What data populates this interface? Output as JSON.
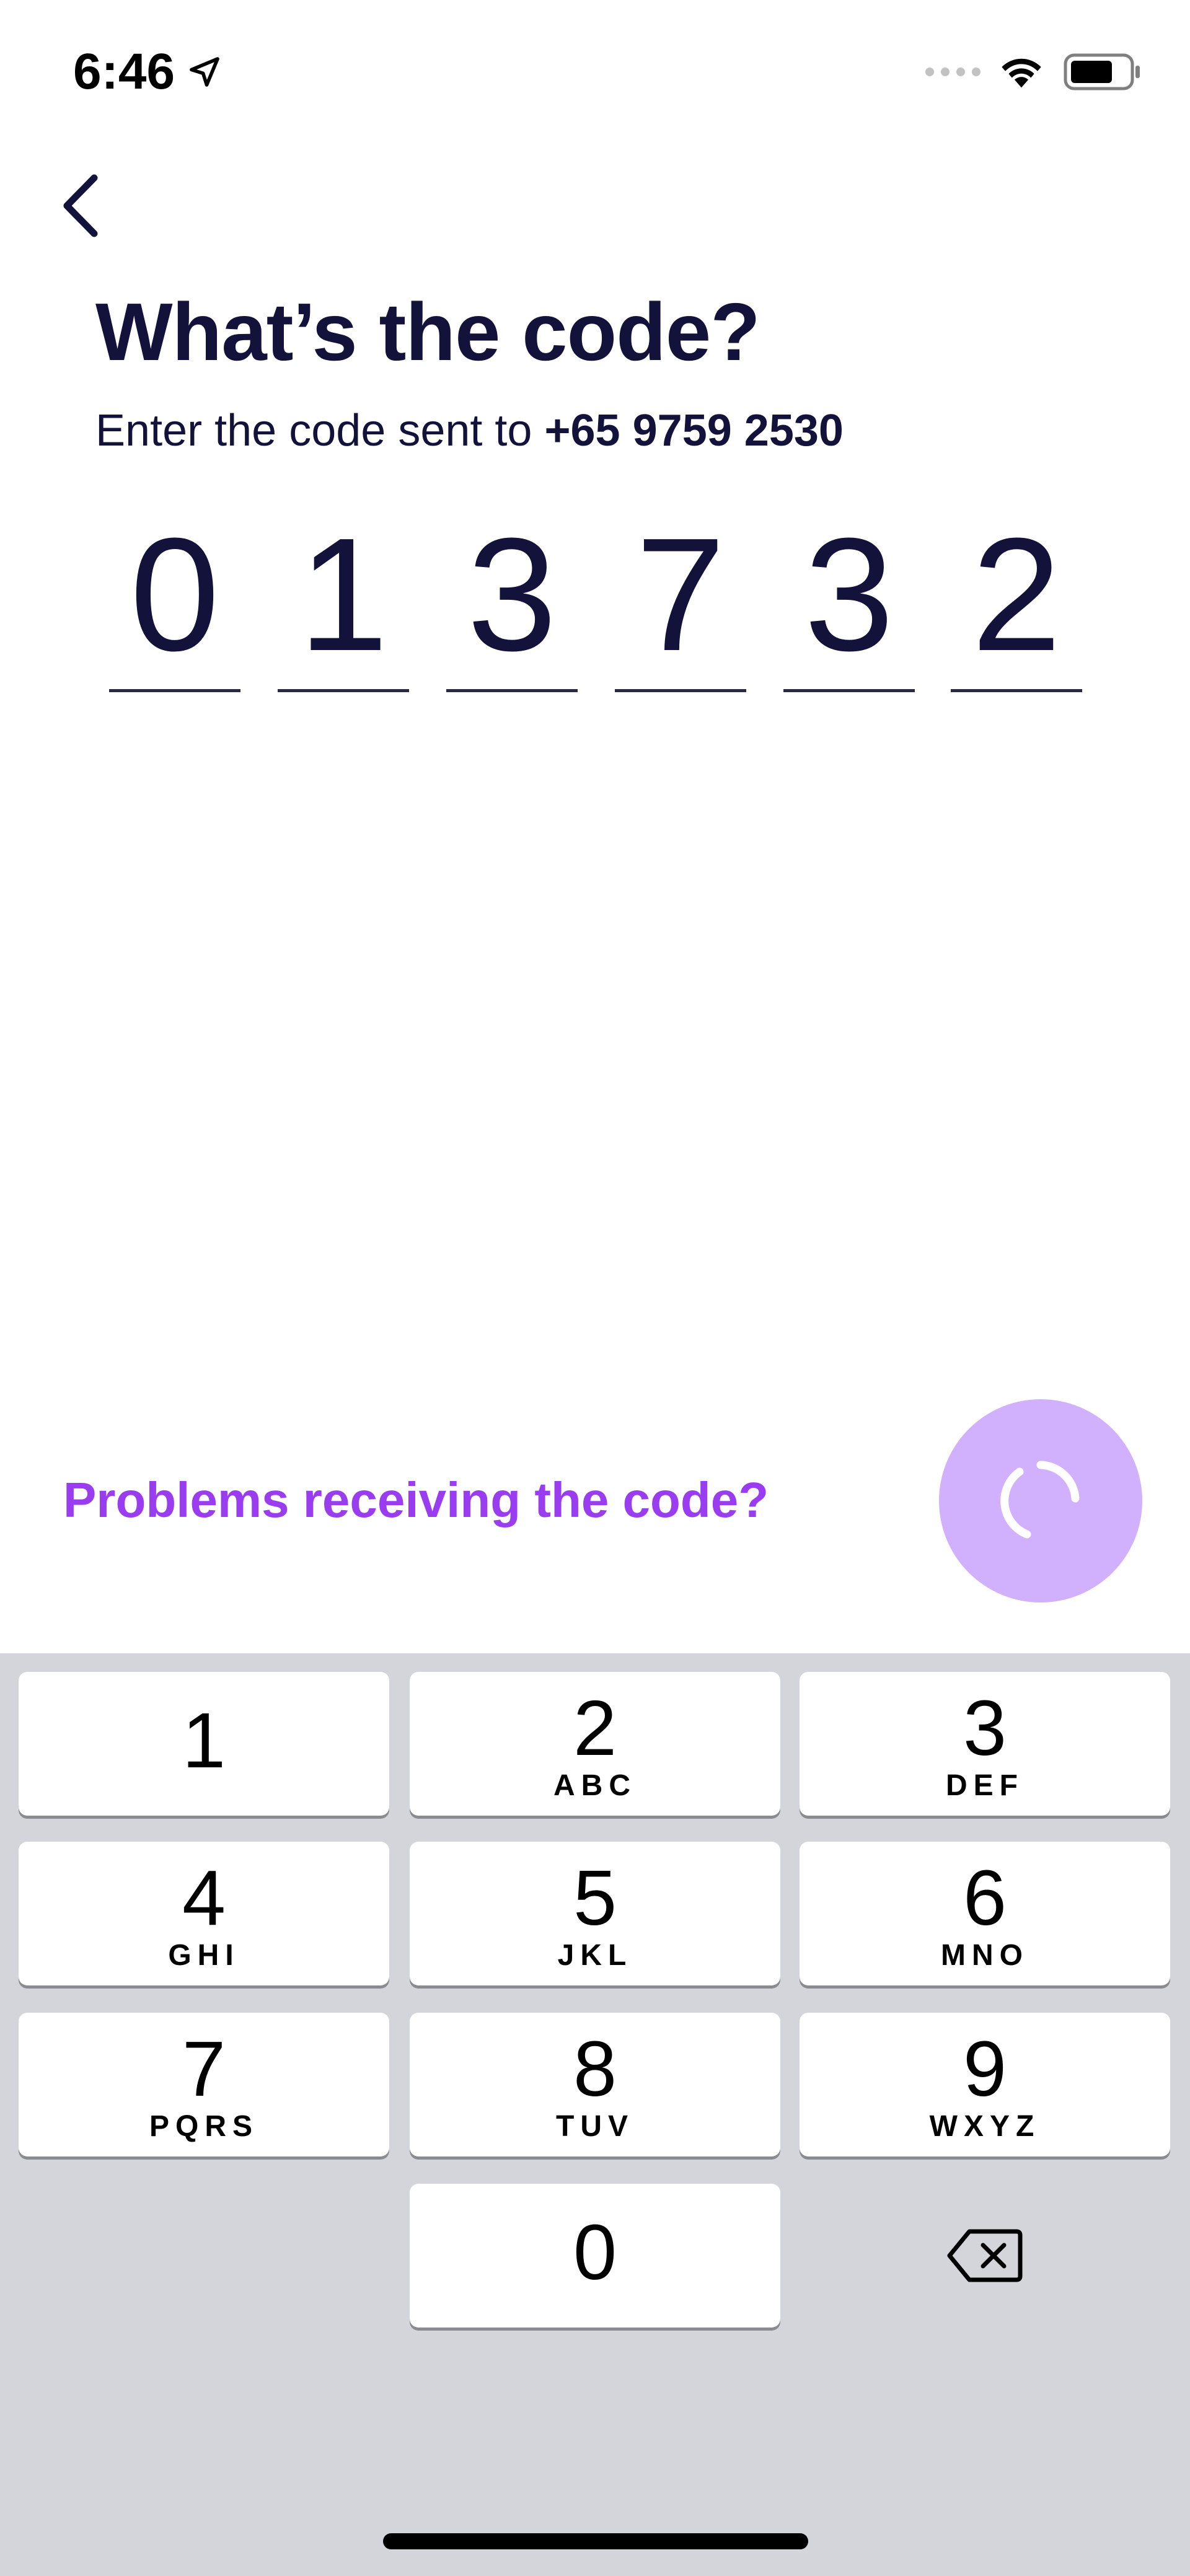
{
  "status_bar": {
    "time": "6:46",
    "icons": [
      "location-arrow-icon",
      "signal-dots-icon",
      "wifi-icon",
      "battery-icon"
    ]
  },
  "header": {
    "back_icon": "chevron-left-icon",
    "title": "What’s the code?",
    "subtitle_prefix": "Enter the code sent to ",
    "phone": "+65 9759 2530"
  },
  "code": {
    "digits": [
      "0",
      "1",
      "3",
      "7",
      "3",
      "2"
    ]
  },
  "actions": {
    "problems_link": "Problems receiving the code?",
    "submit_icon": "loading-spinner-icon"
  },
  "keypad": {
    "keys": [
      {
        "digit": "1",
        "letters": ""
      },
      {
        "digit": "2",
        "letters": "ABC"
      },
      {
        "digit": "3",
        "letters": "DEF"
      },
      {
        "digit": "4",
        "letters": "GHI"
      },
      {
        "digit": "5",
        "letters": "JKL"
      },
      {
        "digit": "6",
        "letters": "MNO"
      },
      {
        "digit": "7",
        "letters": "PQRS"
      },
      {
        "digit": "8",
        "letters": "TUV"
      },
      {
        "digit": "9",
        "letters": "WXYZ"
      },
      {
        "digit": "0",
        "letters": ""
      }
    ],
    "delete_icon": "backspace-icon"
  },
  "colors": {
    "text_dark": "#12123a",
    "accent_purple": "#9a3cf0",
    "spinner_bg": "#d1b1fd",
    "keypad_bg": "#d3d5db"
  }
}
